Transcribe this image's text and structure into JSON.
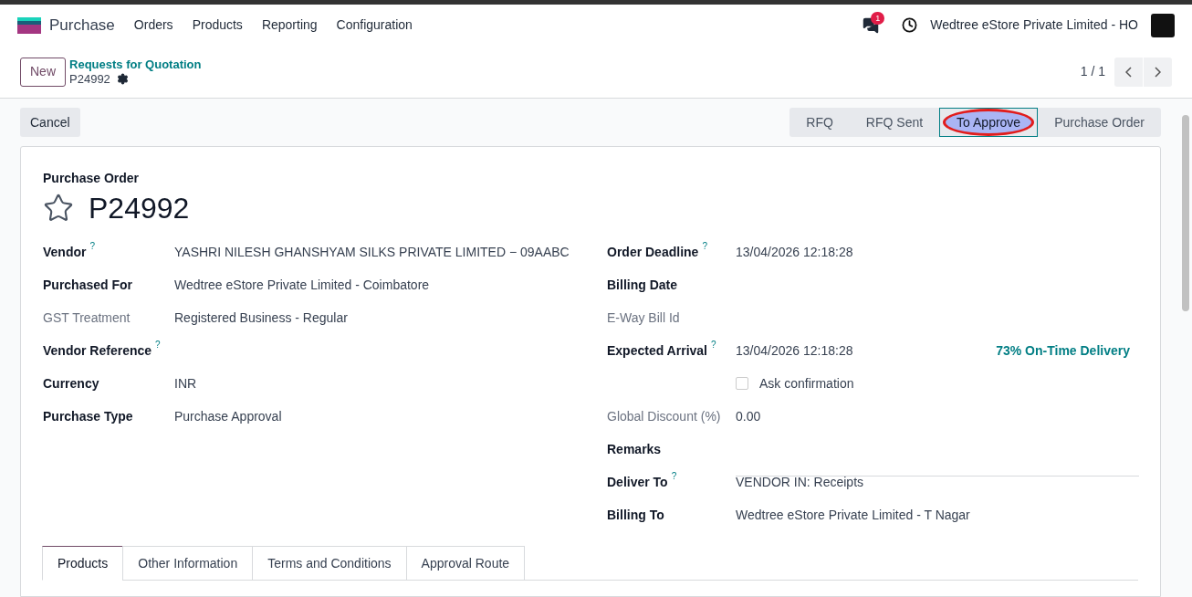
{
  "navbar": {
    "app": "Purchase",
    "menu": [
      "Orders",
      "Products",
      "Reporting",
      "Configuration"
    ],
    "chat_badge": "1",
    "company": "Wedtree eStore Private Limited - HO"
  },
  "control_panel": {
    "new_button": "New",
    "breadcrumb": "Requests for Quotation",
    "record": "P24992",
    "pager": "1 / 1"
  },
  "status_bar": {
    "cancel_button": "Cancel",
    "steps": [
      {
        "label": "RFQ",
        "selected": false
      },
      {
        "label": "RFQ Sent",
        "selected": false
      },
      {
        "label": "To Approve",
        "selected": true,
        "highlighted": true
      },
      {
        "label": "Purchase Order",
        "selected": false
      }
    ]
  },
  "form": {
    "caption": "Purchase Order",
    "title": "P24992",
    "starred": false,
    "left_fields": [
      {
        "kind": "field",
        "label": "Vendor",
        "help": "?",
        "muted": false,
        "value": "YASHRI NILESH GHANSHYAM SILKS PRIVATE LIMITED − 09AABC"
      },
      {
        "kind": "field",
        "label": "Purchased For",
        "muted": false,
        "value": "Wedtree eStore Private Limited - Coimbatore"
      },
      {
        "kind": "field",
        "label": "GST Treatment",
        "muted": true,
        "value": "Registered Business - Regular"
      },
      {
        "kind": "field",
        "label": "Vendor Reference",
        "help": "?",
        "muted": false
      },
      {
        "kind": "field",
        "label": "Currency",
        "muted": false,
        "value": "INR"
      },
      {
        "kind": "field",
        "label": "Purchase Type",
        "muted": false,
        "value": "Purchase Approval"
      }
    ],
    "right_fields": [
      {
        "kind": "field",
        "label": "Order Deadline",
        "help": "?",
        "muted": false,
        "value": "13/04/2026 12:18:28"
      },
      {
        "kind": "field",
        "label": "Billing Date",
        "muted": false
      },
      {
        "kind": "field",
        "label": "E-Way Bill Id",
        "muted": true
      },
      {
        "kind": "field",
        "label": "Expected Arrival",
        "help": "?",
        "muted": false,
        "value": "13/04/2026 12:18:28",
        "aside": "73% On-Time Delivery"
      },
      {
        "kind": "checkbox",
        "value": "Ask confirmation",
        "checked": false
      },
      {
        "kind": "field",
        "label": "Global Discount (%)",
        "muted": true,
        "value": "0.00"
      },
      {
        "kind": "textline",
        "label": "Remarks",
        "muted": false
      },
      {
        "kind": "field",
        "label": "Deliver To",
        "help": "?",
        "muted": false,
        "value": "VENDOR IN: Receipts"
      },
      {
        "kind": "field",
        "label": "Billing To",
        "muted": false,
        "value": "Wedtree eStore Private Limited - T Nagar"
      }
    ],
    "tabs": [
      {
        "label": "Products",
        "selected": true
      },
      {
        "label": "Other Information",
        "selected": false
      },
      {
        "label": "Terms and Conditions",
        "selected": false
      },
      {
        "label": "Approval Route",
        "selected": false
      }
    ]
  }
}
